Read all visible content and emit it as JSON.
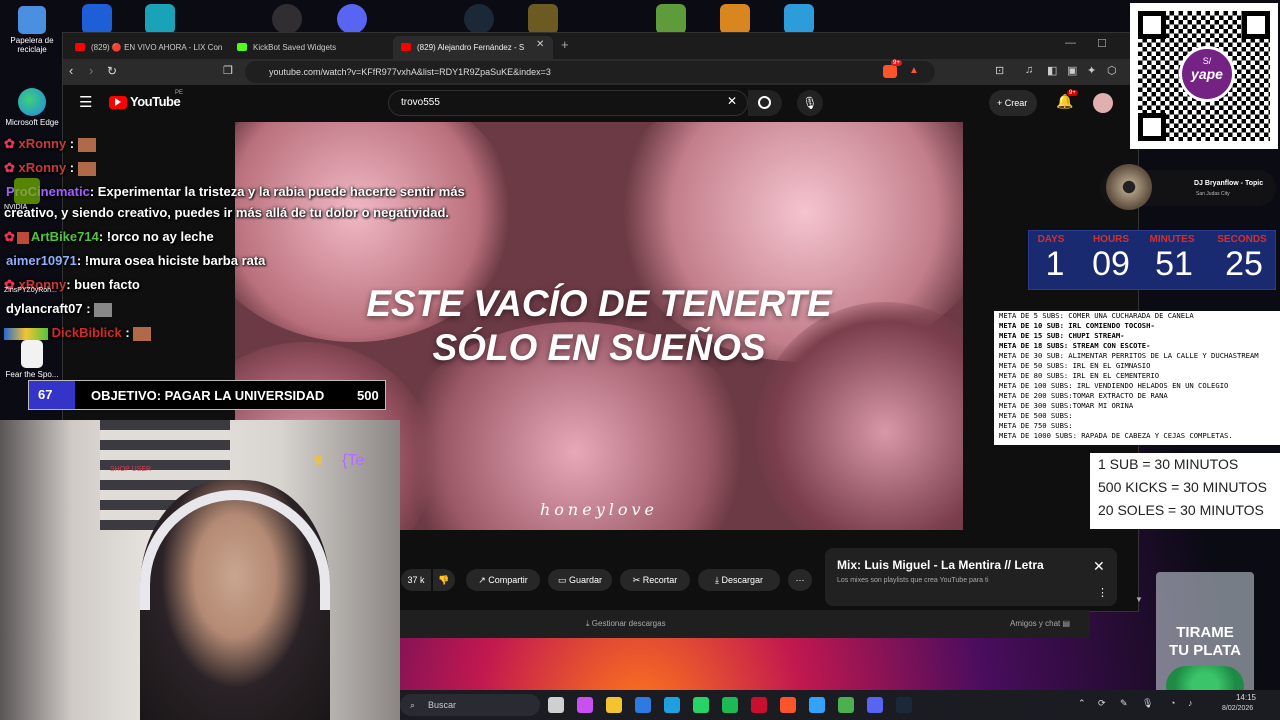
{
  "desktop": {
    "icons": [
      {
        "label": "Papelera de reciclaje",
        "color": "#3a7bd5"
      },
      {
        "label": "Microsoft Edge",
        "color": "#1ea0e0"
      },
      {
        "label": "Fear the Spo...",
        "color": "#ffffff"
      }
    ],
    "top_icons": [
      {
        "name": "app-blue-icon",
        "color": "#1e5fd8"
      },
      {
        "name": "app-cyan-icon",
        "color": "#1aa3b8"
      },
      {
        "name": "obs-icon",
        "color": "#302e31"
      },
      {
        "name": "discord-icon",
        "color": "#5865f2"
      },
      {
        "name": "steam-icon",
        "color": "#1b2838"
      },
      {
        "name": "game-icon",
        "color": "#6b5a22"
      },
      {
        "name": "minecraft-icon",
        "color": "#5e9b3a"
      },
      {
        "name": "counter-strike-icon",
        "color": "#d9861f"
      },
      {
        "name": "file-icon",
        "color": "#2d9cdb"
      }
    ],
    "nvidia_label": "NVIDIA",
    "nvidia_app": "ZinsPYZ0yRoh..."
  },
  "browser": {
    "tabs": [
      {
        "title": "(829) 🔴 EN VIVO AHORA - LIX Con",
        "fav_color": "#ff0000"
      },
      {
        "title": "KickBot Saved Widgets",
        "fav_color": "#53fc18"
      },
      {
        "title": "(829) Alejandro Fernández - S",
        "fav_color": "#ff0000"
      }
    ],
    "url": "youtube.com/watch?v=KFfR977vxhA&list=RDY1R9ZpaSuKE&index=3",
    "extension_badge": "9+",
    "youtube": {
      "logo": "YouTube",
      "region": "PE",
      "search_value": "trovo555",
      "create_label": "Crear",
      "notif_badge": "9+"
    },
    "video": {
      "lyric_line1": "ESTE VACÍO DE TENERTE",
      "lyric_line2": "SÓLO EN SUEÑOS",
      "watermark": "honeylove"
    },
    "actions": {
      "likes": "37 k",
      "share": "Compartir",
      "save": "Guardar",
      "clip": "Recortar",
      "download": "Descargar"
    },
    "mix": {
      "title": "Mix: Luis Miguel - La Mentira // Letra",
      "subtitle": "Los mixes son playlists que crea YouTube para ti"
    },
    "downloads_bar": "Gestionar descargas",
    "friends_chat": "Amigos y chat"
  },
  "chat": [
    {
      "user": "xRonny",
      "user_color": "#c93a3a",
      "msg": ""
    },
    {
      "user": "xRonny",
      "user_color": "#c93a3a",
      "msg": ""
    },
    {
      "user": "ProCinematic",
      "user_color": "#a060ff",
      "msg": ": Experimentar la tristeza y la rabia puede hacerte sentir más"
    },
    {
      "user": "",
      "user_color": "#ffffff",
      "msg": "creativo, y siendo creativo, puedes ir más allá de tu dolor o negatividad."
    },
    {
      "user": "ArtBike714",
      "user_color": "#53c43f",
      "msg": ": !orco no ay leche"
    },
    {
      "user": "aimer10971",
      "user_color": "#8fb0ff",
      "msg": ": !mura osea hiciste barba rata"
    },
    {
      "user": "xRonny",
      "user_color": "#c93a3a",
      "msg": ": buen facto"
    },
    {
      "user": "dylancraft07",
      "user_color": "#ffffff",
      "msg": ":"
    },
    {
      "user": "DickBiblick",
      "user_color": "#d02a2a",
      "msg": ":"
    }
  ],
  "goal": {
    "count": "67",
    "label": "OBJETIVO: PAGAR LA UNIVERSIDAD",
    "target": "500"
  },
  "webcam": {
    "overlay_text": "{Te",
    "shirt_text": "SHOP USER"
  },
  "now_playing": {
    "artist": "DJ Bryanflow - Topic",
    "sub": "San Judas City"
  },
  "timer": {
    "labels": [
      "DAYS",
      "HOURS",
      "MINUTES",
      "SECONDS"
    ],
    "values": [
      "1",
      "09",
      "51",
      "25"
    ]
  },
  "metas": [
    {
      "text": "META DE 5 SUBS: COMER UNA CUCHARADA DE CANELA",
      "bold": false
    },
    {
      "text": "META DE 10 SUB: IRL COMIENDO TOCOSH-",
      "bold": true
    },
    {
      "text": "META DE 15 SUB: CHUPI STREAM-",
      "bold": true
    },
    {
      "text": "META DE 18 SUBS: STREAM CON ESCOTE-",
      "bold": true
    },
    {
      "text": "META DE 30 SUB:  ALIMENTAR PERRITOS DE LA CALLE Y DUCHASTREAM",
      "bold": false
    },
    {
      "text": "META DE 50 SUBS: IRL EN EL GIMNASIO",
      "bold": false
    },
    {
      "text": "META DE 80 SUBS: IRL EN EL CEMENTERIO",
      "bold": false
    },
    {
      "text": "META DE 100 SUBS: IRL VENDIENDO HELADOS EN UN COLEGIO",
      "bold": false
    },
    {
      "text": "META DE 200 SUBS:TOMAR EXTRACTO DE RANA",
      "bold": false
    },
    {
      "text": "META DE 300 SUBS:TOMAR MI ORINA",
      "bold": false
    },
    {
      "text": "META DE 500 SUBS:",
      "bold": false
    },
    {
      "text": "META DE 750 SUBS:",
      "bold": false
    },
    {
      "text": "META DE 1000 SUBS: RAPADA DE CABEZA Y CEJAS COMPLETAS.",
      "bold": false
    }
  ],
  "rates": [
    "1 SUB = 30 MINUTOS",
    "500 KICKS = 30 MINUTOS",
    "20 SOLES = 30 MINUTOS"
  ],
  "qr": {
    "brand": "yape",
    "symbol": "S/"
  },
  "jar": {
    "line1": "TIRAME",
    "line2": "TU PLATA"
  },
  "taskbar": {
    "search_placeholder": "Buscar",
    "time": "14:15",
    "date": "8/02/2026",
    "apps": [
      "#cfcfcf",
      "#c84ff0",
      "#f4c430",
      "#2d7be0",
      "#1ea0e0",
      "#25d366",
      "#1db954",
      "#c8102e",
      "#fb542b",
      "#34a0ff",
      "#4caf50",
      "#5865f2",
      "#1b2838"
    ]
  },
  "colors": {
    "youtube_red": "#ff0000",
    "timer_label": "#d03030",
    "goal_blue": "#3434c8"
  }
}
